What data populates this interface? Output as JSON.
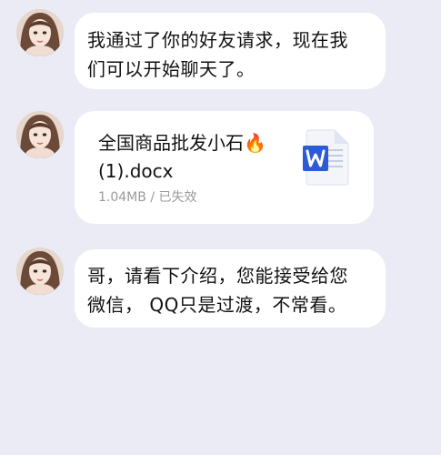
{
  "messages": [
    {
      "type": "text",
      "text": "我通过了你的好友请求，现在我\n们可以开始聊天了。"
    },
    {
      "type": "file",
      "file_name": "全国商品批发小石🔥\n(1).docx",
      "size": "1.04MB",
      "separator": "/",
      "status": "已失效",
      "file_icon": "word-document-icon"
    },
    {
      "type": "text",
      "text": "哥，请看下介绍，您能接受给您\n微信， QQ只是过渡，不常看。"
    }
  ],
  "colors": {
    "background": "#ebebf6",
    "bubble": "#ffffff",
    "meta_text": "#9a9a9a",
    "word_blue": "#2b5bd7"
  }
}
